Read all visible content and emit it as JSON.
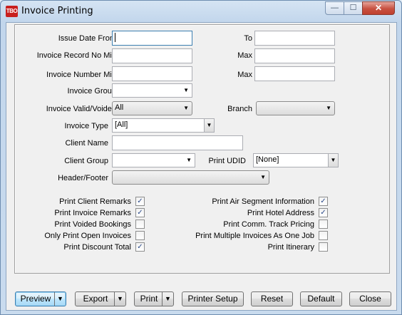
{
  "window": {
    "app_logo": "TBO",
    "title": "Invoice Printing",
    "minimize_glyph": "—",
    "maximize_glyph": "☐",
    "close_glyph": "✕"
  },
  "form": {
    "issue_date_from_label": "Issue Date From",
    "issue_date_from_value": "",
    "issue_date_to_label": "To",
    "issue_date_to_value": "",
    "invoice_record_no_min_label": "Invoice Record No Min",
    "invoice_record_no_min_value": "",
    "invoice_record_no_max_label": "Max",
    "invoice_record_no_max_value": "",
    "invoice_number_min_label": "Invoice Number Min",
    "invoice_number_min_value": "",
    "invoice_number_max_label": "Max",
    "invoice_number_max_value": "",
    "invoice_group_label": "Invoice Group",
    "invoice_group_value": "",
    "invoice_valid_voided_label": "Invoice Valid/Voided",
    "invoice_valid_voided_value": "All",
    "branch_label": "Branch",
    "branch_value": "",
    "invoice_type_label": "Invoice Type",
    "invoice_type_value": "[All]",
    "client_name_label": "Client Name",
    "client_name_value": "",
    "client_group_label": "Client Group",
    "client_group_value": "",
    "print_udid_label": "Print UDID",
    "print_udid_value": "[None]",
    "header_footer_label": "Header/Footer",
    "header_footer_value": "",
    "dropdown_arrow": "▼"
  },
  "checkboxes_left": [
    {
      "label": "Print Client Remarks",
      "checked": true
    },
    {
      "label": "Print Invoice Remarks",
      "checked": true
    },
    {
      "label": "Print Voided Bookings",
      "checked": false
    },
    {
      "label": "Only Print Open Invoices",
      "checked": false
    },
    {
      "label": "Print Discount Total",
      "checked": true
    }
  ],
  "checkboxes_right": [
    {
      "label": "Print Air Segment Information",
      "checked": true
    },
    {
      "label": "Print Hotel Address",
      "checked": true
    },
    {
      "label": "Print Comm. Track Pricing",
      "checked": false
    },
    {
      "label": "Print Multiple Invoices As One Job",
      "checked": false
    },
    {
      "label": "Print Itinerary",
      "checked": false
    }
  ],
  "buttons": {
    "preview": "Preview",
    "export": "Export",
    "print": "Print",
    "printer_setup": "Printer Setup",
    "reset": "Reset",
    "default": "Default",
    "close": "Close"
  }
}
